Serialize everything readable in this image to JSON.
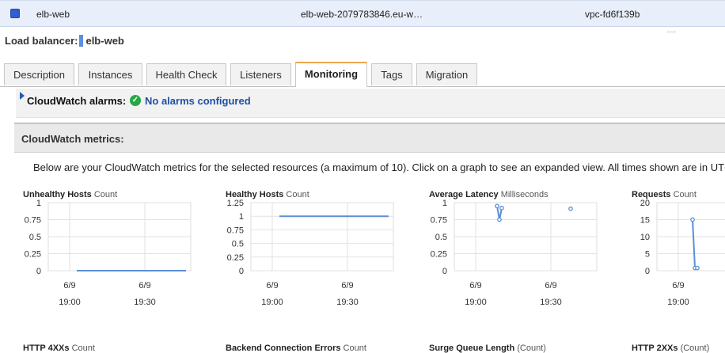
{
  "selected_row": {
    "name": "elb-web",
    "dns": "elb-web-2079783846.eu-w…",
    "vpc": "vpc-fd6f139b"
  },
  "load_balancer": {
    "label": "Load balancer:",
    "name": "elb-web"
  },
  "tabs": [
    {
      "label": "Description"
    },
    {
      "label": "Instances"
    },
    {
      "label": "Health Check"
    },
    {
      "label": "Listeners"
    },
    {
      "label": "Monitoring",
      "active": true
    },
    {
      "label": "Tags"
    },
    {
      "label": "Migration"
    }
  ],
  "alarms": {
    "label": "CloudWatch alarms:",
    "status": "No alarms configured"
  },
  "metrics": {
    "header": "CloudWatch metrics:",
    "description": "Below are your CloudWatch metrics for the selected resources (a maximum of 10). Click on a graph to see an expanded view. All times shown are in UTC."
  },
  "chart_data": [
    {
      "type": "line",
      "title": "Unhealthy Hosts",
      "unit": "Count",
      "yticks": [
        "1",
        "0.75",
        "0.5",
        "0.25",
        "0"
      ],
      "ylim": [
        0,
        1
      ],
      "xticks": [
        [
          "6/9",
          "19:00"
        ],
        [
          "6/9",
          "19:30"
        ]
      ],
      "xlim": [
        0,
        60
      ],
      "series": [
        {
          "x": [
            12,
            23,
            35,
            46,
            58
          ],
          "y": [
            0,
            0,
            0,
            0,
            0
          ],
          "markers": false
        }
      ],
      "color": "#5b8fd6"
    },
    {
      "type": "line",
      "title": "Healthy Hosts",
      "unit": "Count",
      "yticks": [
        "1.25",
        "1",
        "0.75",
        "0.5",
        "0.25",
        "0"
      ],
      "ylim": [
        0,
        1.25
      ],
      "xticks": [
        [
          "6/9",
          "19:00"
        ],
        [
          "6/9",
          "19:30"
        ]
      ],
      "xlim": [
        0,
        60
      ],
      "series": [
        {
          "x": [
            12,
            23,
            35,
            46,
            58
          ],
          "y": [
            1,
            1,
            1,
            1,
            1
          ],
          "markers": false
        }
      ],
      "color": "#5b8fd6"
    },
    {
      "type": "line",
      "title": "Average Latency",
      "unit": "Milliseconds",
      "yticks": [
        "1",
        "0.75",
        "0.5",
        "0.25",
        "0"
      ],
      "ylim": [
        0,
        1
      ],
      "xticks": [
        [
          "6/9",
          "19:00"
        ],
        [
          "6/9",
          "19:30"
        ]
      ],
      "xlim": [
        0,
        60
      ],
      "series": [
        {
          "x": [
            18,
            19,
            20
          ],
          "y": [
            0.95,
            0.75,
            0.92
          ],
          "markers": true
        },
        {
          "x": [
            49
          ],
          "y": [
            0.91
          ],
          "markers": true
        }
      ],
      "color": "#5b8fd6"
    },
    {
      "type": "line",
      "title": "Requests",
      "unit": "Count",
      "yticks": [
        "20",
        "15",
        "10",
        "5",
        "0"
      ],
      "ylim": [
        0,
        20
      ],
      "xticks": [
        [
          "6/9",
          "19:00"
        ]
      ],
      "xlim": [
        0,
        60
      ],
      "series": [
        {
          "x": [
            15,
            16,
            17
          ],
          "y": [
            15,
            0.8,
            0.8
          ],
          "markers": true
        }
      ],
      "color": "#5b8fd6"
    }
  ],
  "next_row": [
    {
      "title": "HTTP 4XXs",
      "unit": "Count"
    },
    {
      "title": "Backend Connection Errors",
      "unit": "Count"
    },
    {
      "title": "Surge Queue Length",
      "unit": "(Count)"
    },
    {
      "title": "HTTP 2XXs",
      "unit": "(Count)"
    }
  ]
}
